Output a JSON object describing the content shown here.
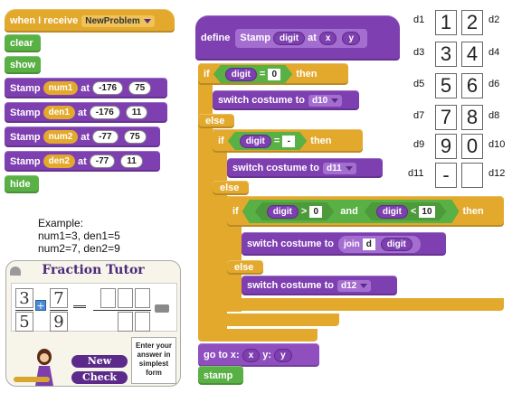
{
  "left_script": {
    "hat": {
      "prefix": "when I receive",
      "message": "NewProblem"
    },
    "clear": "clear",
    "show": "show",
    "stamps": [
      {
        "label": "Stamp",
        "var": "num1",
        "at": "at",
        "x": "-176",
        "y": "75"
      },
      {
        "label": "Stamp",
        "var": "den1",
        "at": "at",
        "x": "-176",
        "y": "11"
      },
      {
        "label": "Stamp",
        "var": "num2",
        "at": "at",
        "x": "-77",
        "y": "75"
      },
      {
        "label": "Stamp",
        "var": "den2",
        "at": "at",
        "x": "-77",
        "y": "11"
      }
    ],
    "hide": "hide"
  },
  "example": {
    "title": "Example:",
    "line1": "num1=3, den1=5",
    "line2": "num2=7, den2=9"
  },
  "tutor": {
    "title": "Fraction Tutor",
    "num1": "3",
    "den1": "5",
    "op": "+",
    "num2": "7",
    "den2": "9",
    "new_button": "New",
    "check_button": "Check",
    "hint": "Enter your answer in simplest form"
  },
  "define_script": {
    "define": "define",
    "proto": {
      "name": "Stamp",
      "p1": "digit",
      "at": "at",
      "p2": "x",
      "p3": "y"
    },
    "if1": {
      "if": "if",
      "var": "digit",
      "op": "=",
      "value": "0",
      "then": "then"
    },
    "costume1": {
      "label": "switch costume to",
      "value": "d10"
    },
    "else1": "else",
    "if2": {
      "if": "if",
      "var": "digit",
      "op": "=",
      "value": "-",
      "then": "then"
    },
    "costume2": {
      "label": "switch costume to",
      "value": "d11"
    },
    "else2": "else",
    "if3": {
      "if": "if",
      "var1": "digit",
      "gt": ">",
      "v1": "0",
      "and": "and",
      "var2": "digit",
      "lt": "<",
      "v2": "10",
      "then": "then"
    },
    "costume3": {
      "label": "switch costume to",
      "join": "join",
      "j1": "d",
      "j2": "digit"
    },
    "else3": "else",
    "costume4": {
      "label": "switch costume to",
      "value": "d12"
    },
    "goto": {
      "label": "go to x:",
      "x": "x",
      "ylabel": "y:",
      "y": "y"
    },
    "stamp": "stamp"
  },
  "costumes": [
    {
      "left": "d1",
      "a": "1",
      "b": "2",
      "right": "d2"
    },
    {
      "left": "d3",
      "a": "3",
      "b": "4",
      "right": "d4"
    },
    {
      "left": "d5",
      "a": "5",
      "b": "6",
      "right": "d6"
    },
    {
      "left": "d7",
      "a": "7",
      "b": "8",
      "right": "d8"
    },
    {
      "left": "d9",
      "a": "9",
      "b": "0",
      "right": "d10"
    },
    {
      "left": "d11",
      "a": "-",
      "b": "",
      "right": "d12"
    }
  ]
}
